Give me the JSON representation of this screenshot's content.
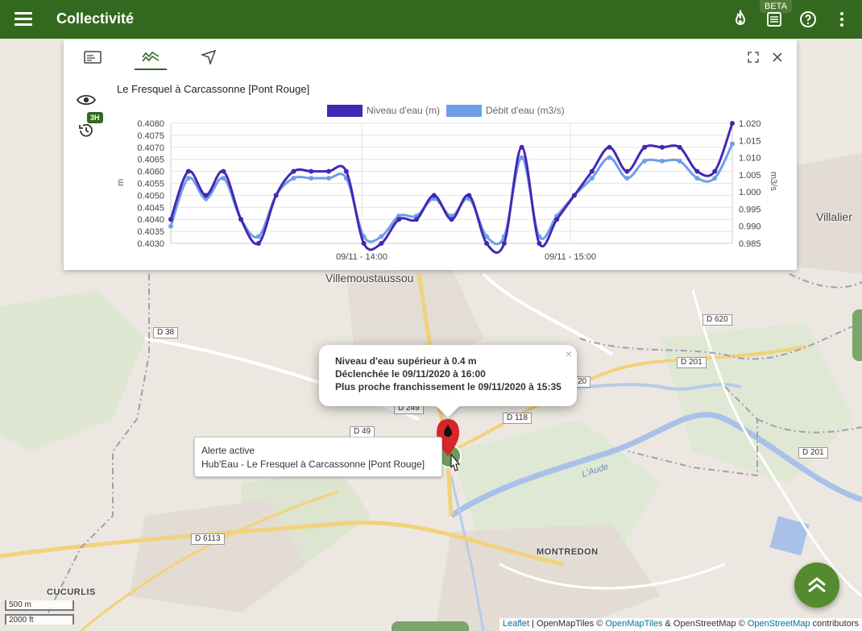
{
  "appbar": {
    "title": "Collectivité",
    "beta": "BETA"
  },
  "panel": {
    "station_title": "Le Fresquel à Carcassonne [Pont Rouge]",
    "history_badge": "3H"
  },
  "chart_data": {
    "type": "line",
    "legend": [
      "Niveau d'eau (m)",
      "Débit d'eau (m3/s)"
    ],
    "xticks": [
      "09/11 - 14:00",
      "09/11 - 15:00"
    ],
    "ylabel_left": "m",
    "ylabel_right": "m3/s",
    "yticks_left": [
      "0.4080",
      "0.4075",
      "0.4070",
      "0.4065",
      "0.4060",
      "0.4055",
      "0.4050",
      "0.4045",
      "0.4040",
      "0.4035",
      "0.4030"
    ],
    "yticks_right": [
      "1.020",
      "1.015",
      "1.010",
      "1.005",
      "1.000",
      "0.995",
      "0.990",
      "0.985"
    ],
    "ylim_left": [
      0.403,
      0.408
    ],
    "ylim_right": [
      0.985,
      1.02
    ],
    "series": [
      {
        "name": "Niveau d'eau (m)",
        "color": "#4527b5",
        "axis": "left",
        "values": [
          0.404,
          0.406,
          0.405,
          0.406,
          0.404,
          0.403,
          0.405,
          0.406,
          0.406,
          0.406,
          0.406,
          0.403,
          0.403,
          0.404,
          0.404,
          0.405,
          0.404,
          0.405,
          0.403,
          0.403,
          0.407,
          0.403,
          0.404,
          0.405,
          0.406,
          0.407,
          0.406,
          0.407,
          0.407,
          0.407,
          0.406,
          0.406,
          0.408
        ]
      },
      {
        "name": "Débit d'eau (m3/s)",
        "color": "#6e9fe6",
        "axis": "right",
        "values": [
          0.99,
          1.004,
          0.998,
          1.004,
          0.992,
          0.987,
          0.999,
          1.004,
          1.004,
          1.004,
          1.004,
          0.987,
          0.987,
          0.993,
          0.993,
          0.998,
          0.993,
          0.998,
          0.987,
          0.987,
          1.01,
          0.987,
          0.993,
          0.999,
          1.004,
          1.01,
          1.004,
          1.009,
          1.009,
          1.009,
          1.004,
          1.004,
          1.014
        ]
      }
    ]
  },
  "alert_popup": {
    "line1": "Niveau d'eau supérieur à 0.4 m",
    "line2": "Déclenchée le 09/11/2020 à 16:00",
    "line3": "Plus proche franchissement le 09/11/2020 à 15:35",
    "close": "×"
  },
  "tooltip": {
    "line1": "Alerte active",
    "line2": "Hub'Eau - Le Fresquel à Carcassonne [Pont Rouge]"
  },
  "map": {
    "places": [
      "Villemoustaussou",
      "Villalier",
      "MONTREDON",
      "CUCURLIS"
    ],
    "roads": [
      "D 38",
      "D 620",
      "D 201",
      "D 201",
      "D 118",
      "D 49",
      "D 249",
      "20",
      "D 6113"
    ],
    "river": "L'Aude"
  },
  "scale": {
    "metric": "500 m",
    "imperial": "2000 ft"
  },
  "attribution": {
    "leaflet": "Leaflet",
    "sep1": " | OpenMapTiles © ",
    "omt": "OpenMapTiles",
    "sep2": " & OpenStreetMap © ",
    "osm": "OpenStreetMap",
    "tail": " contributors"
  }
}
